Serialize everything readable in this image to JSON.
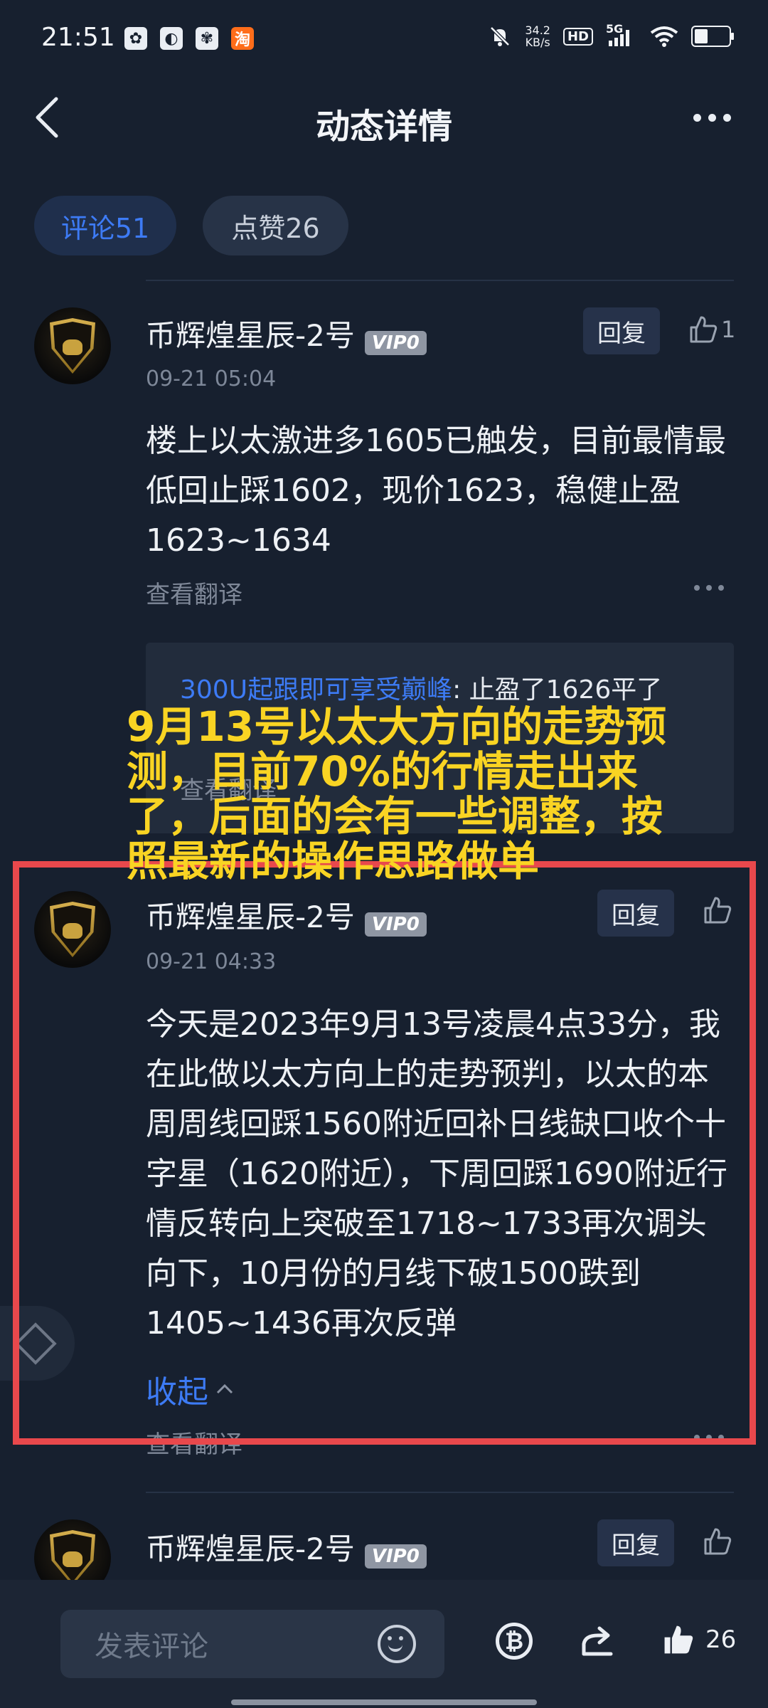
{
  "status_bar": {
    "time": "21:51",
    "speed_value": "34.2",
    "speed_unit": "KB/s",
    "hd": "HD",
    "network": "5G",
    "app_icons": [
      "wechat-icon",
      "browser-icon",
      "baidu-icon",
      "taobao-icon"
    ],
    "taobao_glyph": "淘"
  },
  "header": {
    "title": "动态详情"
  },
  "tabs": [
    {
      "label": "评论51",
      "active": true
    },
    {
      "label": "点赞26",
      "active": false
    }
  ],
  "comments": [
    {
      "username": "币辉煌星辰-2号",
      "vip": "VIP0",
      "time": "09-21 05:04",
      "reply_label": "回复",
      "likes": "1",
      "body": "楼上以太激进多1605已触发，目前最情最低回止踩1602，现价1623，稳健止盈1623~1634",
      "translate_label": "查看翻译",
      "nested_reply": {
        "user": "300U起跟即可享受巅峰",
        "text": ": 止盈了1626平了",
        "translate_label": "查看翻译"
      }
    },
    {
      "username": "币辉煌星辰-2号",
      "vip": "VIP0",
      "time": "09-21 04:33",
      "reply_label": "回复",
      "likes": "",
      "body": "今天是2023年9月13号凌晨4点33分，我在此做以太方向上的走势预判，以太的本周周线回踩1560附近回补日线缺口收个十字星（1620附近），下周回踩1690附近行情反转向上突破至1718~1733再次调头向下，10月份的月线下破1500跌到1405~1436再次反弹",
      "collapse_label": "收起",
      "translate_label": "查看翻译"
    },
    {
      "username": "币辉煌星辰-2号",
      "vip": "VIP0",
      "reply_label": "回复"
    }
  ],
  "overlay": {
    "caption": "9月13号以太大方向的走势预测，目前70%的行情走出来了，后面的会有一些调整，按照最新的操作思路做单",
    "box_color": "#e8484c",
    "text_color": "#f9d423"
  },
  "bottom_bar": {
    "input_placeholder": "发表评论",
    "coin_glyph": "₿",
    "like_count": "26"
  },
  "colors": {
    "background": "#17202f",
    "accent": "#3d7bf5",
    "card": "#222c3c"
  }
}
